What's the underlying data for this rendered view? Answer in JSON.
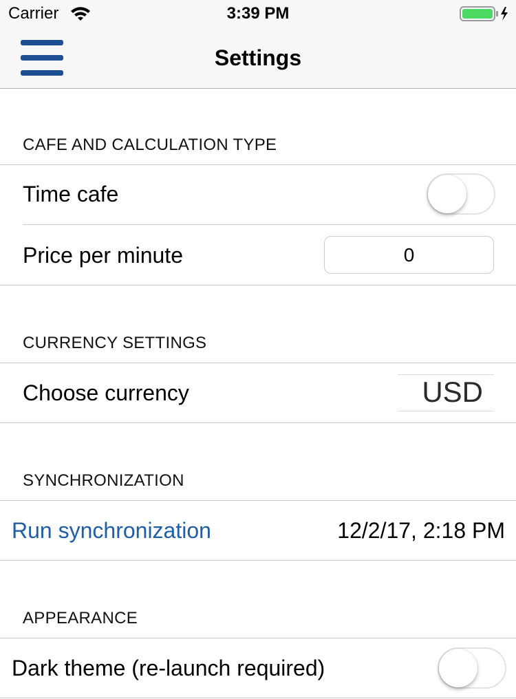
{
  "status_bar": {
    "carrier": "Carrier",
    "time": "3:39 PM",
    "wifi_icon": "wifi-icon",
    "battery_icon": "battery-charging-icon",
    "battery_level": 1.0
  },
  "nav": {
    "title": "Settings",
    "menu_icon": "hamburger-menu-icon"
  },
  "sections": {
    "cafe": {
      "header": "CAFE AND CALCULATION TYPE",
      "time_cafe": {
        "label": "Time cafe",
        "enabled": false
      },
      "price_per_minute": {
        "label": "Price per minute",
        "value": "0"
      }
    },
    "currency": {
      "header": "CURRENCY SETTINGS",
      "choose": {
        "label": "Choose currency",
        "selected": "USD"
      }
    },
    "sync": {
      "header": "SYNCHRONIZATION",
      "action_label": "Run synchronization",
      "last_sync": "12/2/17, 2:18 PM"
    },
    "appearance": {
      "header": "APPEARANCE",
      "dark_theme": {
        "label": "Dark theme (re-launch required)",
        "enabled": false
      }
    }
  },
  "colors": {
    "accent": "#1f5da6",
    "menu_icon": "#1f4f93",
    "battery": "#4cd964",
    "nav_background": "#f7f7f7",
    "separator": "#c8c7cc"
  }
}
